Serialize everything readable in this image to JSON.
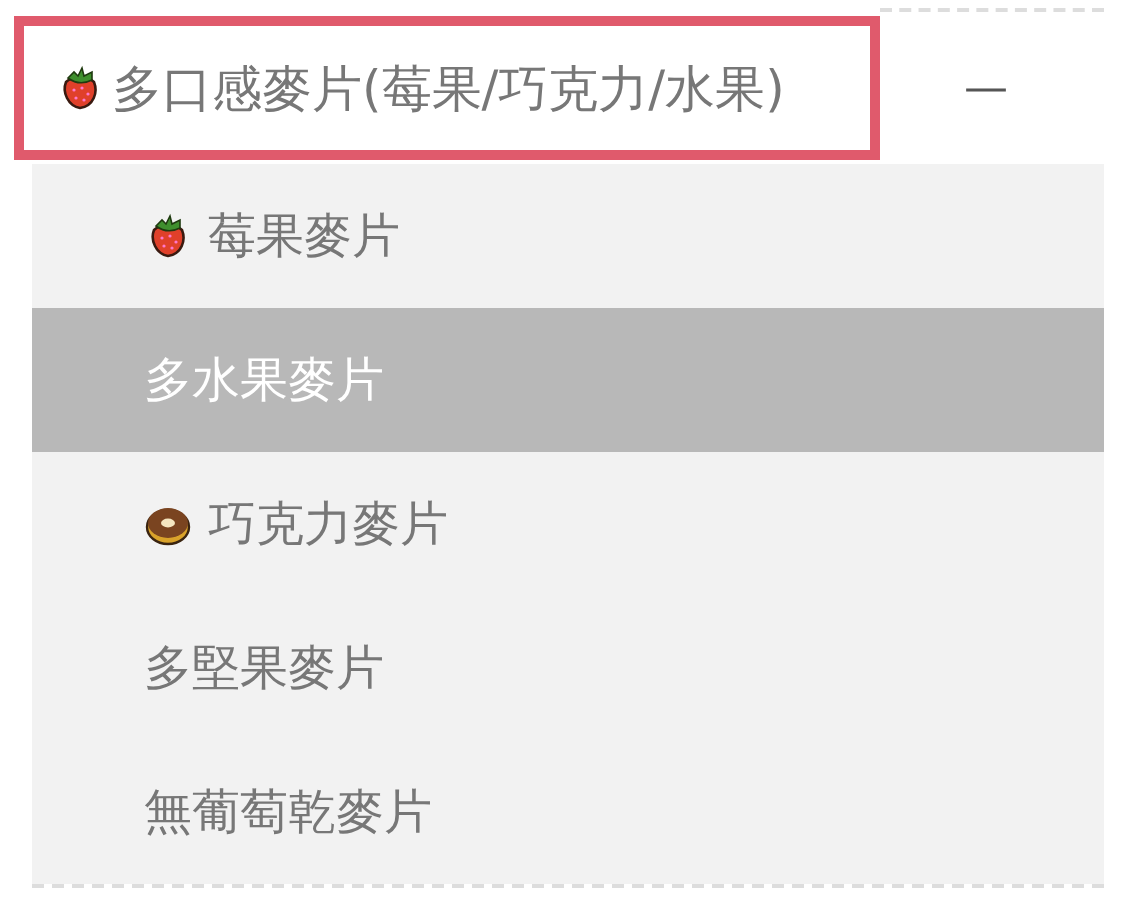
{
  "category": {
    "label": "多口感麥片(莓果/巧克力/水果)",
    "kind": "strawberry",
    "highlighted": true,
    "toggle": "—",
    "expanded": true
  },
  "items": [
    {
      "label": "莓果麥片",
      "kind": "strawberry",
      "selected": false
    },
    {
      "label": "多水果麥片",
      "kind": "plain",
      "selected": true
    },
    {
      "label": "巧克力麥片",
      "kind": "donut",
      "selected": false
    },
    {
      "label": "多堅果麥片",
      "kind": "plain",
      "selected": false
    },
    {
      "label": "無葡萄乾麥片",
      "kind": "plain",
      "selected": false
    }
  ]
}
